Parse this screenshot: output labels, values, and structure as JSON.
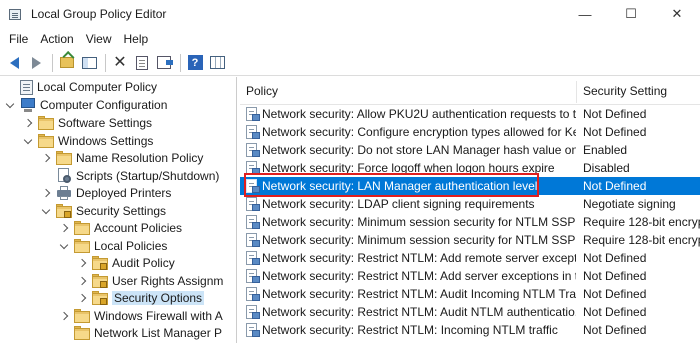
{
  "window": {
    "title": "Local Group Policy Editor",
    "minimize": "—",
    "maximize": "☐",
    "close": "✕"
  },
  "menu": [
    "File",
    "Action",
    "View",
    "Help"
  ],
  "toolbar": [
    "back-icon",
    "forward-icon",
    "up-folder-icon",
    "show-hide-tree-icon",
    "delete-icon",
    "properties-icon",
    "export-list-icon",
    "help-icon",
    "filter-icon"
  ],
  "tree": [
    {
      "label": "Local Computer Policy",
      "icon": "policy-icon",
      "chevron": "none"
    },
    {
      "label": "Computer Configuration",
      "icon": "computer-icon",
      "chevron": "down"
    },
    {
      "label": "Software Settings",
      "icon": "folder-icon",
      "chevron": "right"
    },
    {
      "label": "Windows Settings",
      "icon": "folder-icon",
      "chevron": "down"
    },
    {
      "label": "Name Resolution Policy",
      "icon": "folder-icon",
      "chevron": "right"
    },
    {
      "label": "Scripts (Startup/Shutdown)",
      "icon": "script-icon",
      "chevron": "none"
    },
    {
      "label": "Deployed Printers",
      "icon": "printer-icon",
      "chevron": "right"
    },
    {
      "label": "Security Settings",
      "icon": "security-folder-icon",
      "chevron": "down"
    },
    {
      "label": "Account Policies",
      "icon": "folder-icon",
      "chevron": "right"
    },
    {
      "label": "Local Policies",
      "icon": "folder-icon",
      "chevron": "down"
    },
    {
      "label": "Audit Policy",
      "icon": "folder-icon",
      "chevron": "right"
    },
    {
      "label": "User Rights Assignm",
      "icon": "folder-icon",
      "chevron": "right"
    },
    {
      "label": "Security Options",
      "icon": "folder-icon",
      "chevron": "right",
      "selected": true
    },
    {
      "label": "Windows Firewall with A",
      "icon": "folder-icon",
      "chevron": "right"
    },
    {
      "label": "Network List Manager P",
      "icon": "folder-icon",
      "chevron": "none"
    }
  ],
  "list": {
    "columns": {
      "policy": "Policy",
      "setting": "Security Setting"
    },
    "rows": [
      {
        "policy": "Network security: Allow PKU2U authentication requests to t...",
        "setting": "Not Defined"
      },
      {
        "policy": "Network security: Configure encryption types allowed for Ke...",
        "setting": "Not Defined"
      },
      {
        "policy": "Network security: Do not store LAN Manager hash value on ...",
        "setting": "Enabled"
      },
      {
        "policy": "Network security: Force logoff when logon hours expire",
        "setting": "Disabled"
      },
      {
        "policy": "Network security: LAN Manager authentication level",
        "setting": "Not Defined",
        "selected": true
      },
      {
        "policy": "Network security: LDAP client signing requirements",
        "setting": "Negotiate signing"
      },
      {
        "policy": "Network security: Minimum session security for NTLM SSP ...",
        "setting": "Require 128-bit encrypti"
      },
      {
        "policy": "Network security: Minimum session security for NTLM SSP ...",
        "setting": "Require 128-bit encrypti"
      },
      {
        "policy": "Network security: Restrict NTLM: Add remote server excepti...",
        "setting": "Not Defined"
      },
      {
        "policy": "Network security: Restrict NTLM: Add server exceptions in t...",
        "setting": "Not Defined"
      },
      {
        "policy": "Network security: Restrict NTLM: Audit Incoming NTLM Tra...",
        "setting": "Not Defined"
      },
      {
        "policy": "Network security: Restrict NTLM: Audit NTLM authenticatio...",
        "setting": "Not Defined"
      },
      {
        "policy": "Network security: Restrict NTLM: Incoming NTLM traffic",
        "setting": "Not Defined"
      }
    ]
  },
  "colors": {
    "selection": "#0078d7",
    "tree_selection": "#cce4f7",
    "highlight_box": "#e01e1e"
  }
}
